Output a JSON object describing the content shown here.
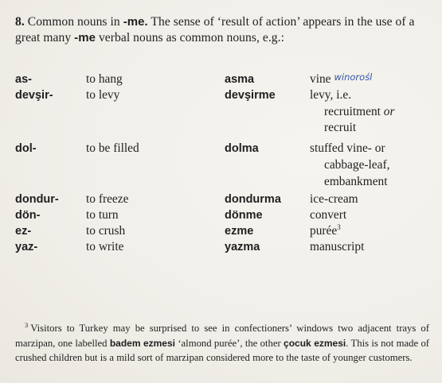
{
  "heading": {
    "number": "8.",
    "text_a": "Common nouns in",
    "suffix": "-me.",
    "text_b": "The sense of ‘result of action’ appears in the use of a great many",
    "suffix2": "-me",
    "text_c": "verbal nouns as common nouns, e.g.:"
  },
  "rows": [
    {
      "verb": "as-",
      "meaning": "to hang",
      "noun": "asma",
      "noun_meaning": "vine",
      "handnote": "winorośl"
    },
    {
      "verb": "devşir-",
      "meaning": "to levy",
      "noun": "devşirme",
      "noun_meaning": "levy, i.e.",
      "cont1_a": "recruitment",
      "cont1_or": "or",
      "cont2": "recruit"
    },
    {
      "verb": "dol-",
      "meaning": "to be filled",
      "noun": "dolma",
      "noun_meaning": "stuffed vine- or",
      "cont1": "cabbage-leaf,",
      "cont2": "embankment"
    },
    {
      "verb": "dondur-",
      "meaning": "to freeze",
      "noun": "dondurma",
      "noun_meaning": "ice-cream"
    },
    {
      "verb": "dön-",
      "meaning": "to turn",
      "noun": "dönme",
      "noun_meaning": "convert"
    },
    {
      "verb": "ez-",
      "meaning": "to crush",
      "noun": "ezme",
      "noun_meaning": "purée",
      "note_ref": "3"
    },
    {
      "verb": "yaz-",
      "meaning": "to write",
      "noun": "yazma",
      "noun_meaning": "manuscript"
    }
  ],
  "footnote": {
    "mark": "3",
    "text_a": "Visitors to Turkey may be surprised to see in confectioners’ windows two adjacent trays of marzipan, one labelled",
    "term1": "badem ezmesi",
    "text_b": "‘almond purée’, the other",
    "term2": "çocuk ezmesi",
    "text_c": ". This is not made of crushed children but is a mild sort of marzipan considered more to the taste of younger customers."
  }
}
